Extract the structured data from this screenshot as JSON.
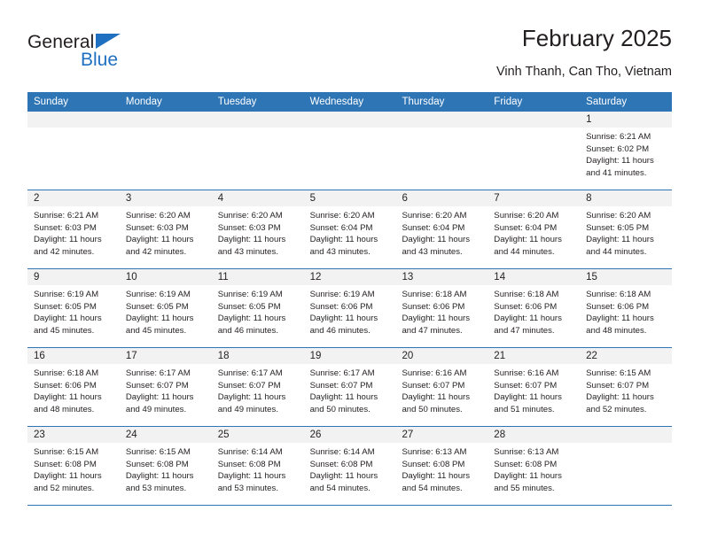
{
  "brand": {
    "name_part1": "General",
    "name_part2": "Blue",
    "accent_color": "#1f70c1"
  },
  "header": {
    "title": "February 2025",
    "subtitle": "Vinh Thanh, Can Tho, Vietnam",
    "header_bg_color": "#2e75b6",
    "daynum_band_color": "#f2f2f2"
  },
  "calendar": {
    "weekday_headers": [
      "Sunday",
      "Monday",
      "Tuesday",
      "Wednesday",
      "Thursday",
      "Friday",
      "Saturday"
    ],
    "weeks": [
      [
        {
          "day": "",
          "sunrise": "",
          "sunset": "",
          "daylight": "",
          "empty": true
        },
        {
          "day": "",
          "sunrise": "",
          "sunset": "",
          "daylight": "",
          "empty": true
        },
        {
          "day": "",
          "sunrise": "",
          "sunset": "",
          "daylight": "",
          "empty": true
        },
        {
          "day": "",
          "sunrise": "",
          "sunset": "",
          "daylight": "",
          "empty": true
        },
        {
          "day": "",
          "sunrise": "",
          "sunset": "",
          "daylight": "",
          "empty": true
        },
        {
          "day": "",
          "sunrise": "",
          "sunset": "",
          "daylight": "",
          "empty": true
        },
        {
          "day": "1",
          "sunrise": "Sunrise: 6:21 AM",
          "sunset": "Sunset: 6:02 PM",
          "daylight": "Daylight: 11 hours and 41 minutes.",
          "empty": false
        }
      ],
      [
        {
          "day": "2",
          "sunrise": "Sunrise: 6:21 AM",
          "sunset": "Sunset: 6:03 PM",
          "daylight": "Daylight: 11 hours and 42 minutes.",
          "empty": false
        },
        {
          "day": "3",
          "sunrise": "Sunrise: 6:20 AM",
          "sunset": "Sunset: 6:03 PM",
          "daylight": "Daylight: 11 hours and 42 minutes.",
          "empty": false
        },
        {
          "day": "4",
          "sunrise": "Sunrise: 6:20 AM",
          "sunset": "Sunset: 6:03 PM",
          "daylight": "Daylight: 11 hours and 43 minutes.",
          "empty": false
        },
        {
          "day": "5",
          "sunrise": "Sunrise: 6:20 AM",
          "sunset": "Sunset: 6:04 PM",
          "daylight": "Daylight: 11 hours and 43 minutes.",
          "empty": false
        },
        {
          "day": "6",
          "sunrise": "Sunrise: 6:20 AM",
          "sunset": "Sunset: 6:04 PM",
          "daylight": "Daylight: 11 hours and 43 minutes.",
          "empty": false
        },
        {
          "day": "7",
          "sunrise": "Sunrise: 6:20 AM",
          "sunset": "Sunset: 6:04 PM",
          "daylight": "Daylight: 11 hours and 44 minutes.",
          "empty": false
        },
        {
          "day": "8",
          "sunrise": "Sunrise: 6:20 AM",
          "sunset": "Sunset: 6:05 PM",
          "daylight": "Daylight: 11 hours and 44 minutes.",
          "empty": false
        }
      ],
      [
        {
          "day": "9",
          "sunrise": "Sunrise: 6:19 AM",
          "sunset": "Sunset: 6:05 PM",
          "daylight": "Daylight: 11 hours and 45 minutes.",
          "empty": false
        },
        {
          "day": "10",
          "sunrise": "Sunrise: 6:19 AM",
          "sunset": "Sunset: 6:05 PM",
          "daylight": "Daylight: 11 hours and 45 minutes.",
          "empty": false
        },
        {
          "day": "11",
          "sunrise": "Sunrise: 6:19 AM",
          "sunset": "Sunset: 6:05 PM",
          "daylight": "Daylight: 11 hours and 46 minutes.",
          "empty": false
        },
        {
          "day": "12",
          "sunrise": "Sunrise: 6:19 AM",
          "sunset": "Sunset: 6:06 PM",
          "daylight": "Daylight: 11 hours and 46 minutes.",
          "empty": false
        },
        {
          "day": "13",
          "sunrise": "Sunrise: 6:18 AM",
          "sunset": "Sunset: 6:06 PM",
          "daylight": "Daylight: 11 hours and 47 minutes.",
          "empty": false
        },
        {
          "day": "14",
          "sunrise": "Sunrise: 6:18 AM",
          "sunset": "Sunset: 6:06 PM",
          "daylight": "Daylight: 11 hours and 47 minutes.",
          "empty": false
        },
        {
          "day": "15",
          "sunrise": "Sunrise: 6:18 AM",
          "sunset": "Sunset: 6:06 PM",
          "daylight": "Daylight: 11 hours and 48 minutes.",
          "empty": false
        }
      ],
      [
        {
          "day": "16",
          "sunrise": "Sunrise: 6:18 AM",
          "sunset": "Sunset: 6:06 PM",
          "daylight": "Daylight: 11 hours and 48 minutes.",
          "empty": false
        },
        {
          "day": "17",
          "sunrise": "Sunrise: 6:17 AM",
          "sunset": "Sunset: 6:07 PM",
          "daylight": "Daylight: 11 hours and 49 minutes.",
          "empty": false
        },
        {
          "day": "18",
          "sunrise": "Sunrise: 6:17 AM",
          "sunset": "Sunset: 6:07 PM",
          "daylight": "Daylight: 11 hours and 49 minutes.",
          "empty": false
        },
        {
          "day": "19",
          "sunrise": "Sunrise: 6:17 AM",
          "sunset": "Sunset: 6:07 PM",
          "daylight": "Daylight: 11 hours and 50 minutes.",
          "empty": false
        },
        {
          "day": "20",
          "sunrise": "Sunrise: 6:16 AM",
          "sunset": "Sunset: 6:07 PM",
          "daylight": "Daylight: 11 hours and 50 minutes.",
          "empty": false
        },
        {
          "day": "21",
          "sunrise": "Sunrise: 6:16 AM",
          "sunset": "Sunset: 6:07 PM",
          "daylight": "Daylight: 11 hours and 51 minutes.",
          "empty": false
        },
        {
          "day": "22",
          "sunrise": "Sunrise: 6:15 AM",
          "sunset": "Sunset: 6:07 PM",
          "daylight": "Daylight: 11 hours and 52 minutes.",
          "empty": false
        }
      ],
      [
        {
          "day": "23",
          "sunrise": "Sunrise: 6:15 AM",
          "sunset": "Sunset: 6:08 PM",
          "daylight": "Daylight: 11 hours and 52 minutes.",
          "empty": false
        },
        {
          "day": "24",
          "sunrise": "Sunrise: 6:15 AM",
          "sunset": "Sunset: 6:08 PM",
          "daylight": "Daylight: 11 hours and 53 minutes.",
          "empty": false
        },
        {
          "day": "25",
          "sunrise": "Sunrise: 6:14 AM",
          "sunset": "Sunset: 6:08 PM",
          "daylight": "Daylight: 11 hours and 53 minutes.",
          "empty": false
        },
        {
          "day": "26",
          "sunrise": "Sunrise: 6:14 AM",
          "sunset": "Sunset: 6:08 PM",
          "daylight": "Daylight: 11 hours and 54 minutes.",
          "empty": false
        },
        {
          "day": "27",
          "sunrise": "Sunrise: 6:13 AM",
          "sunset": "Sunset: 6:08 PM",
          "daylight": "Daylight: 11 hours and 54 minutes.",
          "empty": false
        },
        {
          "day": "28",
          "sunrise": "Sunrise: 6:13 AM",
          "sunset": "Sunset: 6:08 PM",
          "daylight": "Daylight: 11 hours and 55 minutes.",
          "empty": false
        },
        {
          "day": "",
          "sunrise": "",
          "sunset": "",
          "daylight": "",
          "empty": true
        }
      ]
    ]
  }
}
